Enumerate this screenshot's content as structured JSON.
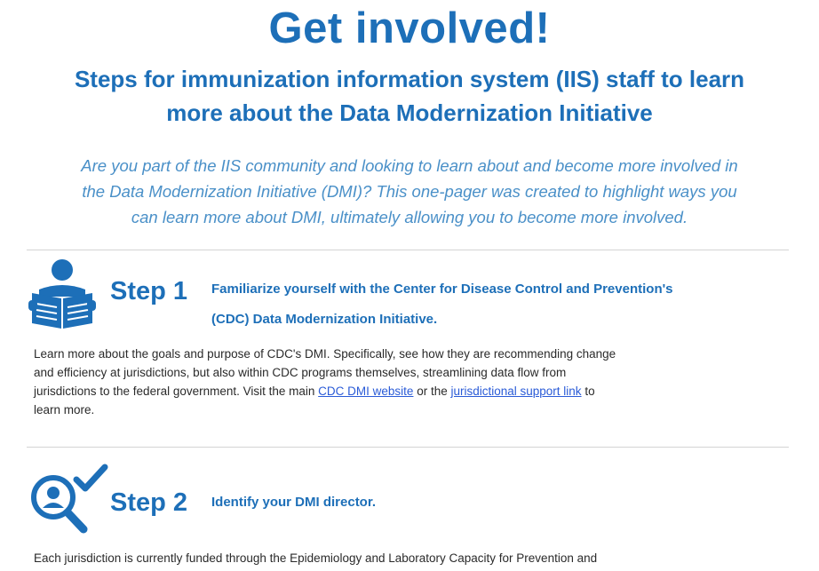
{
  "header": {
    "title": "Get involved!",
    "subtitle_line1": "Steps for immunization information system (IIS) staff to learn",
    "subtitle_line2": "more about the Data Modernization Initiative"
  },
  "intro": {
    "line1": "Are you part of the IIS community and looking to learn about and become more involved in",
    "line2": "the Data Modernization Initiative (DMI)? This one-pager was created to highlight ways you",
    "line3": "can learn more about DMI, ultimately allowing you to become more involved."
  },
  "steps": [
    {
      "label": "Step 1",
      "icon": "reader-book-icon",
      "heading_line1": "Familiarize yourself with the Center for Disease Control and Prevention's",
      "heading_line2": "(CDC) Data Modernization Initiative.",
      "body_line1": "Learn more about the goals and purpose of CDC's DMI. Specifically, see how they are recommending change",
      "body_line2": "and efficiency at jurisdictions, but also within CDC programs themselves, streamlining data flow from",
      "body_line3_before": "jurisdictions to the federal government. Visit the main ",
      "link1": "CDC DMI website",
      "body_line3_mid": " or the ",
      "link2": "jurisdictional support link",
      "body_line3_after": " to",
      "body_line4": "learn more."
    },
    {
      "label": "Step 2",
      "icon": "person-search-check-icon",
      "heading_line1": "Identify your DMI director.",
      "body_line1": "Each jurisdiction is currently funded through the Epidemiology and Laboratory Capacity for Prevention and"
    }
  ],
  "colors": {
    "brand_blue": "#1d6fb8",
    "intro_blue": "#4a90c8",
    "link_blue": "#2a5bd7"
  }
}
